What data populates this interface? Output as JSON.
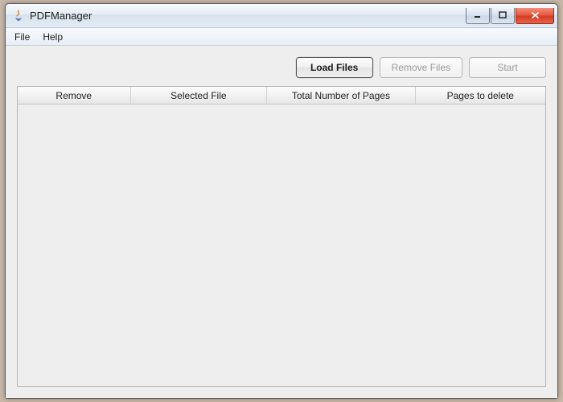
{
  "window": {
    "title": "PDFManager"
  },
  "menubar": {
    "file": "File",
    "help": "Help"
  },
  "toolbar": {
    "load_files": "Load Files",
    "remove_files": "Remove Files",
    "start": "Start"
  },
  "table": {
    "columns": {
      "remove": "Remove",
      "selected_file": "Selected File",
      "total_pages": "Total Number of Pages",
      "pages_to_delete": "Pages to delete"
    },
    "rows": []
  }
}
